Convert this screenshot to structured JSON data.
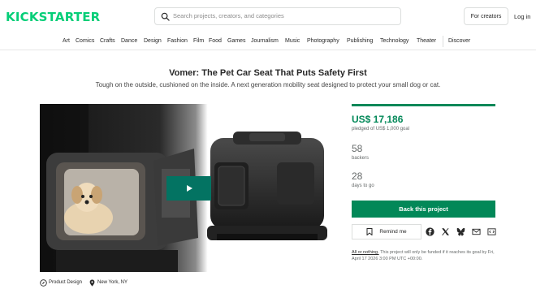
{
  "header": {
    "logo": "KICKSTARTER",
    "search_placeholder": "Search projects, creators, and categories",
    "for_creators": "For creators",
    "login": "Log in"
  },
  "categories": [
    "Art",
    "Comics",
    "Crafts",
    "Dance",
    "Design",
    "Fashion",
    "Film",
    "Food",
    "Games",
    "Journalism",
    "Music",
    "Photography",
    "Publishing",
    "Technology",
    "Theater",
    "Discover"
  ],
  "project": {
    "title": "Vomer: The Pet Car Seat That Puts Safety First",
    "subtitle": "Tough on the outside, cushioned on the inside. A next generation mobility seat designed to protect your small dog or cat.",
    "progress_fraction": 1.0
  },
  "stats": {
    "pledged": "US$ 17,186",
    "pledged_sub": "pledged of US$ 1,000 goal",
    "backers": "58",
    "backers_label": "backers",
    "days": "28",
    "days_label": "days to go"
  },
  "actions": {
    "back": "Back this project",
    "remind": "Remind me"
  },
  "funding": {
    "all_or_nothing": "All or nothing.",
    "note": " This project will only be funded if it reaches its goal by Fri, April 17 2026 3:00 PM UTC +00:00."
  },
  "meta": {
    "category": "Product Design",
    "location": "New York, NY"
  },
  "colors": {
    "brand": "#05ce78",
    "accent": "#028858"
  },
  "icons": {
    "search": "search-icon",
    "play": "play-icon",
    "bookmark": "bookmark-icon",
    "social": [
      "facebook-icon",
      "x-icon",
      "bluesky-icon",
      "email-icon",
      "embed-icon"
    ],
    "category": "compass-icon",
    "location": "location-pin-icon"
  }
}
